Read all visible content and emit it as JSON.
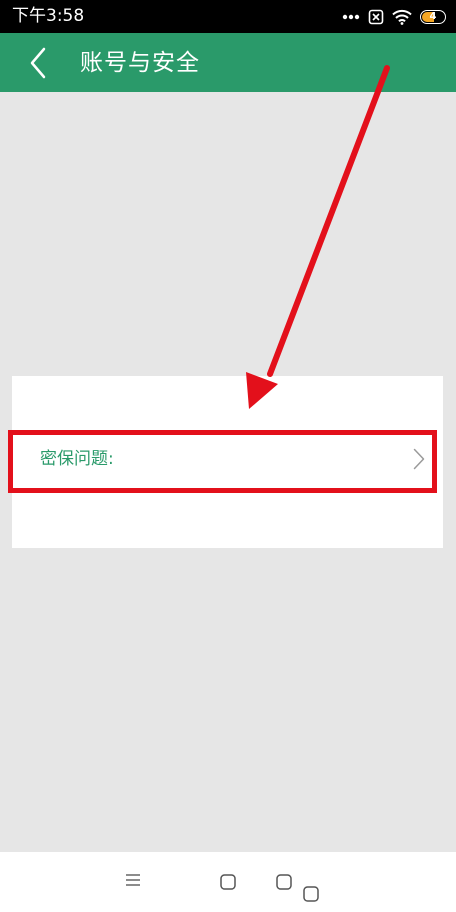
{
  "status_bar": {
    "time": "下午3:58",
    "battery_level": "4"
  },
  "header": {
    "title": "账号与安全"
  },
  "settings": {
    "security_question_label": "密保问题:"
  },
  "colors": {
    "header_bg": "#2a9a6a",
    "page_bg": "#e6e6e6",
    "label_green": "#2a9a6a",
    "annotation_red": "#e3101b",
    "battery_orange": "#f5a623"
  },
  "icons": {
    "back": "chevron-left-icon",
    "row_arrow": "chevron-right-icon",
    "nav_menu": "menu-icon",
    "nav_home": "square-icon",
    "nav_recent": "square-icon"
  }
}
